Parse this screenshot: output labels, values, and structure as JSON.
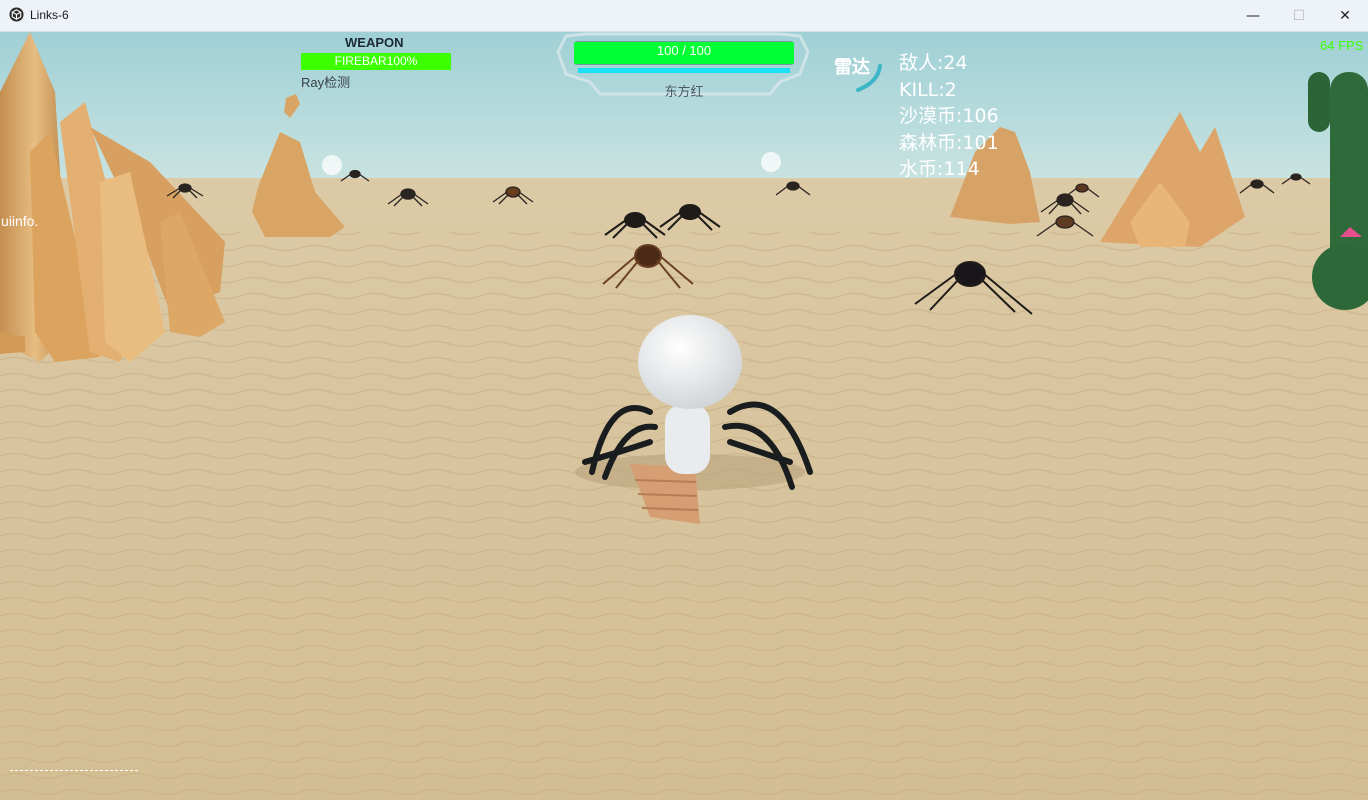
{
  "window": {
    "title": "Links-6",
    "minimize_glyph": "—",
    "maximize_glyph": "☐",
    "close_glyph": "✕",
    "app_icon": "unity-cube-icon"
  },
  "hud": {
    "weapon": {
      "label": "WEAPON",
      "bar_text": "FIREBAR100%",
      "bar_fill_percent": 100,
      "bar_color": "#3cff00",
      "detect_label": "Ray检测"
    },
    "health": {
      "text": "100 / 100",
      "fill_percent": 100,
      "bar_color": "#00ff33",
      "shield_color": "#19e0f5",
      "character_name": "东方红"
    },
    "radar": {
      "label": "雷达"
    },
    "stats": {
      "enemies": "敌人:24",
      "kills": "KILL:2",
      "desert_coins": "沙漠币:106",
      "forest_coins": "森林币:101",
      "water_coins": "水币:114"
    },
    "fps": "64 FPS",
    "uiinfo": "uiinfo."
  },
  "colors": {
    "sky": "#b6dde0",
    "sand": "#d6c19a",
    "rock": "#d9a868",
    "fps_green": "#3cff00"
  }
}
